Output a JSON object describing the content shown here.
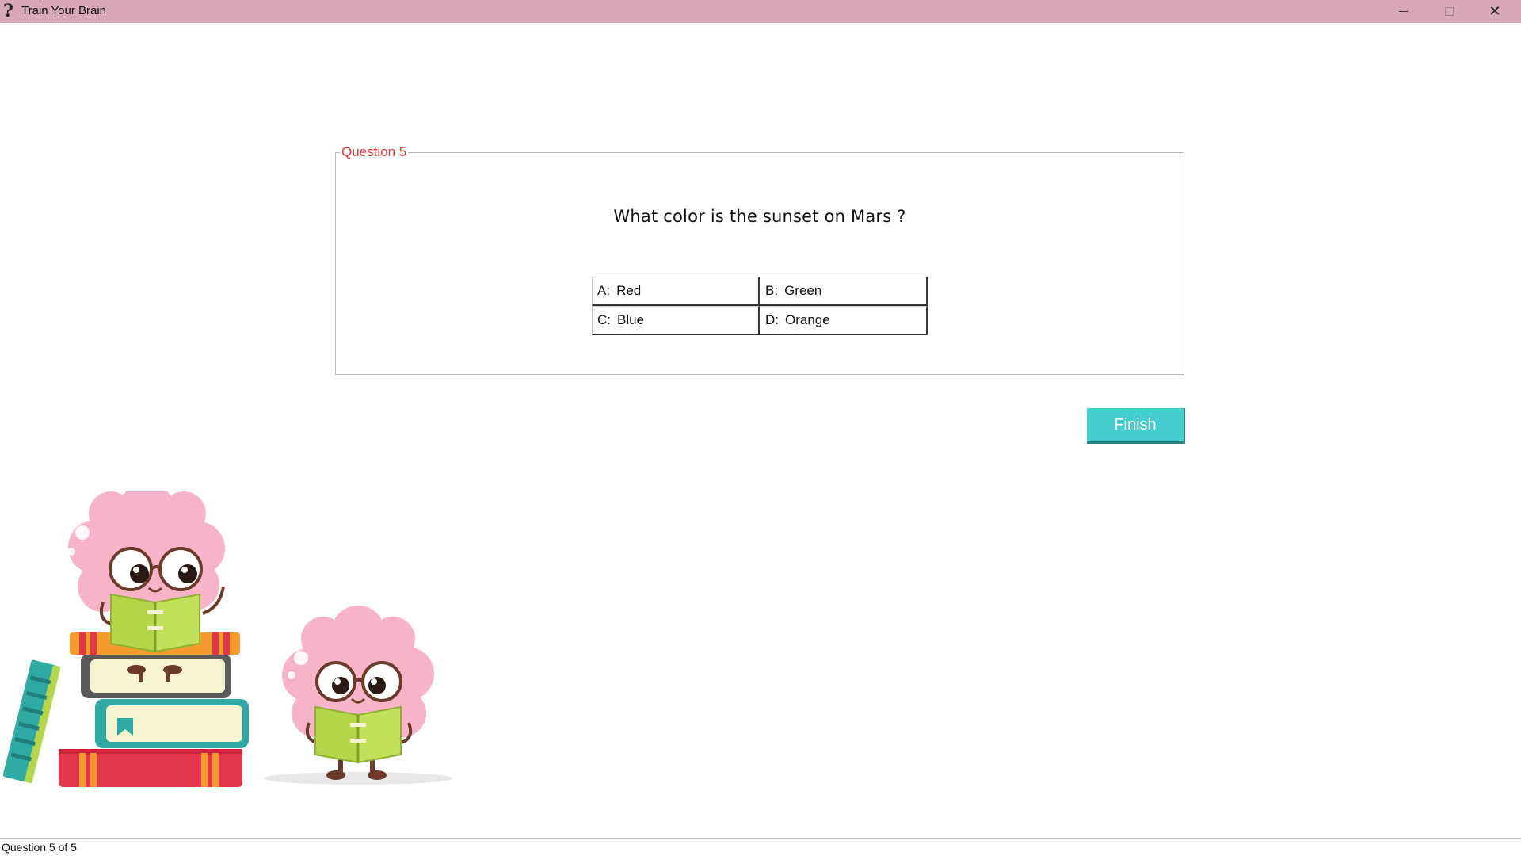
{
  "window": {
    "title": "Train Your Brain",
    "icon": "question-mark-icon",
    "icon_glyph": "?",
    "controls": {
      "minimize": "minimize-icon",
      "maximize": "maximize-icon",
      "close": "close-icon",
      "close_glyph": "✕"
    }
  },
  "question": {
    "group_title": "Question 5",
    "text": "What color is the sunset on Mars ?",
    "answers": [
      {
        "key": "A:",
        "label": "Red"
      },
      {
        "key": "B:",
        "label": "Green"
      },
      {
        "key": "C:",
        "label": "Blue"
      },
      {
        "key": "D:",
        "label": "Orange"
      }
    ]
  },
  "actions": {
    "finish_label": "Finish"
  },
  "status": {
    "text": "Question 5 of 5"
  },
  "colors": {
    "titlebar": "#d7a8b6",
    "legend": "#e0353c",
    "finish_button": "#46cdcd",
    "brain": "#f7b3c8",
    "book_green": "#b5d64a"
  },
  "illustration": {
    "name": "brain-characters-reading-books"
  }
}
